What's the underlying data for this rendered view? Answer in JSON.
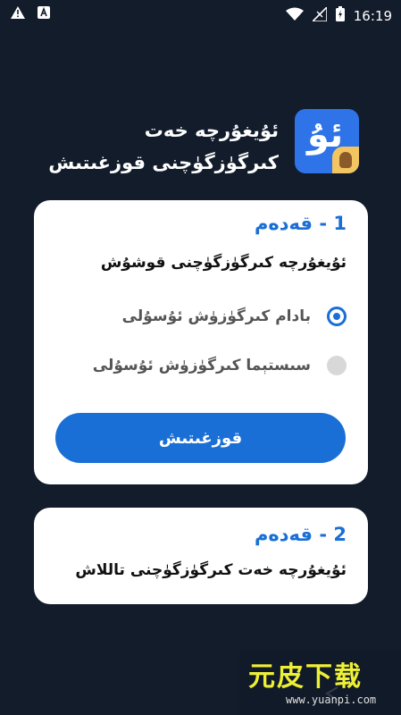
{
  "status_bar": {
    "time": "16:19",
    "left_icons": [
      "warning-icon",
      "a-badge-icon"
    ],
    "right_icons": [
      "wifi-icon",
      "sim-signal-icon",
      "battery-charging-icon"
    ]
  },
  "header": {
    "app_title": "ئۇيغۇرچە خەت كىرگۈزگۈچنى قوزغىتىش",
    "app_icon_glyph": "ئۇ"
  },
  "step1": {
    "title": "1 - قەدەم",
    "subtitle": "ئۇيغۇرچە كىرگۈزگۈچنى قوشۇش",
    "options": [
      {
        "label": "بادام كىرگۈزۈش ئۇسۇلى",
        "selected": true
      },
      {
        "label": "سىستېما كىرگۈزۈش ئۇسۇلى",
        "selected": false
      }
    ],
    "button_label": "قوزغىتىش"
  },
  "step2": {
    "title": "2 - قەدەم",
    "subtitle": "ئۇيغۇرچە خەت كىرگۈزگۈچنى تاللاش"
  },
  "watermark": {
    "logo_text": "元皮下载",
    "url": "www.yuanpi.com"
  },
  "colors": {
    "background": "#131c2b",
    "accent": "#1a6fd6",
    "card": "#ffffff"
  }
}
